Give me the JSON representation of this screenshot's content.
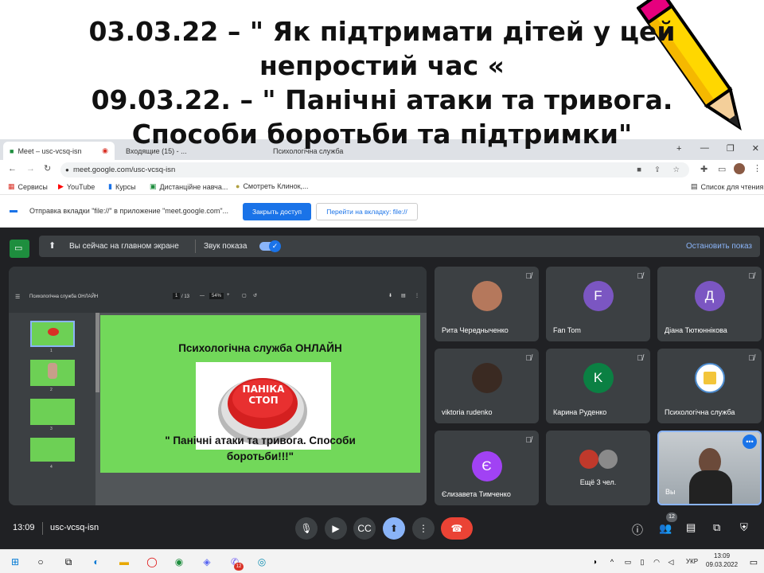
{
  "slide": {
    "line1": "03.03.22 – \" Як підтримати дітей у цей",
    "line2": "непростий час «",
    "line3": "09.03.22. – \" Панічні атаки та тривога.",
    "line4": "Способи боротьби та підтримки\""
  },
  "browser": {
    "tab_active": "Meet – usc-vcsq-isn",
    "tab2": "Входящие (15) - ...",
    "tab3": "Психологічна служба",
    "url": "meet.google.com/usc-vcsq-isn",
    "bookmarks": [
      "Сервисы",
      "YouTube",
      "Курсы",
      "Дистанційне навча...",
      "Смотреть Клинок,..."
    ],
    "reading_list": "Список для чтения",
    "info_text": "Отправка вкладки \"file://\" в приложение \"meet.google.com\"...",
    "btn_grant": "Закрыть доступ",
    "btn_goto": "Перейти на вкладку: file://"
  },
  "meet": {
    "share_status": "Вы сейчас на главном экране",
    "share_sound": "Звук показа",
    "stop_share": "Остановить показ",
    "pdf_title": "Психологічна служба ОНЛАЙН",
    "pdf_page": "1",
    "pdf_total": "/ 13",
    "pdf_zoom": "54%",
    "page_heading": "Психологічна служба ОНЛАЙН",
    "panic_line1": "ПАНІКА",
    "panic_line2": "СТОП",
    "page_sub1": "\" Панічні атаки та тривога. Способи",
    "page_sub2": "боротьби!!!\"",
    "thumb_nums": [
      "1",
      "2",
      "3",
      "4"
    ],
    "participants": [
      {
        "name": "Рита Чередныченко",
        "initial": "",
        "color": "#8a5a44"
      },
      {
        "name": "Fan Tom",
        "initial": "F",
        "color": "#7b56c2"
      },
      {
        "name": "Діана Тютюннікова",
        "initial": "Д",
        "color": "#7b56c2"
      },
      {
        "name": "viktoria rudenko",
        "initial": "",
        "color": "#3a2a22"
      },
      {
        "name": "Карина Руденко",
        "initial": "K",
        "color": "#0b8043"
      },
      {
        "name": "Психологічна служба",
        "initial": "",
        "color": "#ffffff"
      },
      {
        "name": "Єлизавета Тимченко",
        "initial": "Є",
        "color": "#a142f4"
      },
      {
        "name": "Ещё 3 чел.",
        "initial": "",
        "color": "#3c4043"
      },
      {
        "name": "Вы",
        "initial": "",
        "color": "#3c4043"
      }
    ],
    "time": "13:09",
    "meeting_code": "usc-vcsq-isn",
    "participant_count": "12"
  },
  "taskbar": {
    "lang": "УКР",
    "time": "13:09",
    "date": "09.03.2022",
    "badge": "12"
  }
}
